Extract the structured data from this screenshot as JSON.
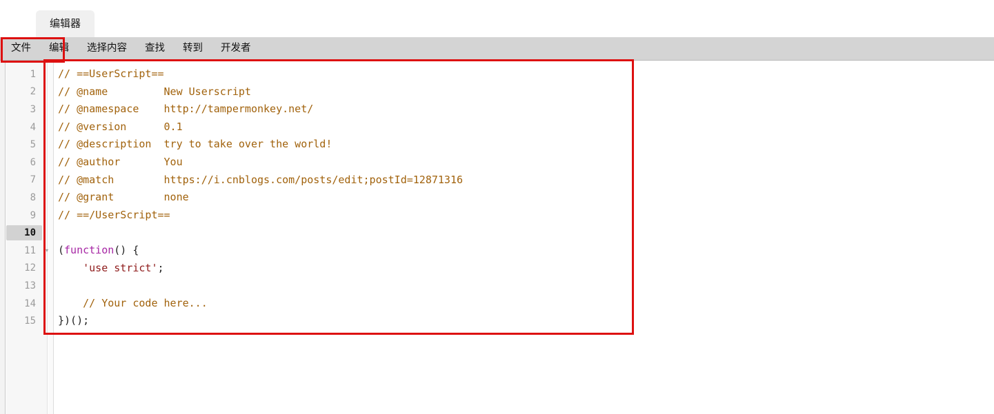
{
  "window": {
    "title": "编辑器"
  },
  "tabs": [
    {
      "label": "编辑器",
      "active": true
    }
  ],
  "menubar": {
    "items": [
      {
        "name": "file",
        "label": "文件"
      },
      {
        "name": "edit",
        "label": "编辑"
      },
      {
        "name": "selection",
        "label": "选择内容"
      },
      {
        "name": "find",
        "label": "查找"
      },
      {
        "name": "goto",
        "label": "转到"
      },
      {
        "name": "developer",
        "label": "开发者"
      }
    ]
  },
  "editor": {
    "active_line": 10,
    "lines": [
      {
        "num": "1",
        "fold": "",
        "active": false,
        "tokens": [
          {
            "cls": "c-comment",
            "text": "// ==UserScript=="
          }
        ]
      },
      {
        "num": "2",
        "fold": "",
        "active": false,
        "tokens": [
          {
            "cls": "c-comment",
            "text": "// @name         New Userscript"
          }
        ]
      },
      {
        "num": "3",
        "fold": "",
        "active": false,
        "tokens": [
          {
            "cls": "c-comment",
            "text": "// @namespace    http://tampermonkey.net/"
          }
        ]
      },
      {
        "num": "4",
        "fold": "",
        "active": false,
        "tokens": [
          {
            "cls": "c-comment",
            "text": "// @version      0.1"
          }
        ]
      },
      {
        "num": "5",
        "fold": "",
        "active": false,
        "tokens": [
          {
            "cls": "c-comment",
            "text": "// @description  try to take over the world!"
          }
        ]
      },
      {
        "num": "6",
        "fold": "",
        "active": false,
        "tokens": [
          {
            "cls": "c-comment",
            "text": "// @author       You"
          }
        ]
      },
      {
        "num": "7",
        "fold": "",
        "active": false,
        "tokens": [
          {
            "cls": "c-comment",
            "text": "// @match        https://i.cnblogs.com/posts/edit;postId=12871316"
          }
        ]
      },
      {
        "num": "8",
        "fold": "",
        "active": false,
        "tokens": [
          {
            "cls": "c-comment",
            "text": "// @grant        none"
          }
        ]
      },
      {
        "num": "9",
        "fold": "",
        "active": false,
        "tokens": [
          {
            "cls": "c-comment",
            "text": "// ==/UserScript=="
          }
        ]
      },
      {
        "num": "10",
        "fold": "",
        "active": true,
        "tokens": [
          {
            "cls": "c-plain",
            "text": ""
          }
        ]
      },
      {
        "num": "11",
        "fold": "▾",
        "active": false,
        "tokens": [
          {
            "cls": "c-plain",
            "text": "("
          },
          {
            "cls": "c-keyword",
            "text": "function"
          },
          {
            "cls": "c-plain",
            "text": "() {"
          }
        ]
      },
      {
        "num": "12",
        "fold": "",
        "active": false,
        "tokens": [
          {
            "cls": "c-plain",
            "text": "    "
          },
          {
            "cls": "c-string",
            "text": "'use strict'"
          },
          {
            "cls": "c-plain",
            "text": ";"
          }
        ]
      },
      {
        "num": "13",
        "fold": "",
        "active": false,
        "tokens": [
          {
            "cls": "c-plain",
            "text": ""
          }
        ]
      },
      {
        "num": "14",
        "fold": "",
        "active": false,
        "tokens": [
          {
            "cls": "c-plain",
            "text": "    "
          },
          {
            "cls": "c-comment",
            "text": "// Your code here..."
          }
        ]
      },
      {
        "num": "15",
        "fold": "",
        "active": false,
        "tokens": [
          {
            "cls": "c-plain",
            "text": "})();"
          }
        ]
      }
    ]
  },
  "annotations": [
    {
      "name": "menu-highlight",
      "color": "#dd1010"
    },
    {
      "name": "code-highlight",
      "color": "#dd1010"
    }
  ],
  "colors": {
    "annotation_red": "#dd1010",
    "menubar_bg": "#d4d4d4",
    "tab_bg": "#f0f0f0",
    "comment": "#a1620c",
    "keyword": "#a626a4",
    "string": "#8e1b1b",
    "active_line_badge": "#d2d2d2"
  }
}
